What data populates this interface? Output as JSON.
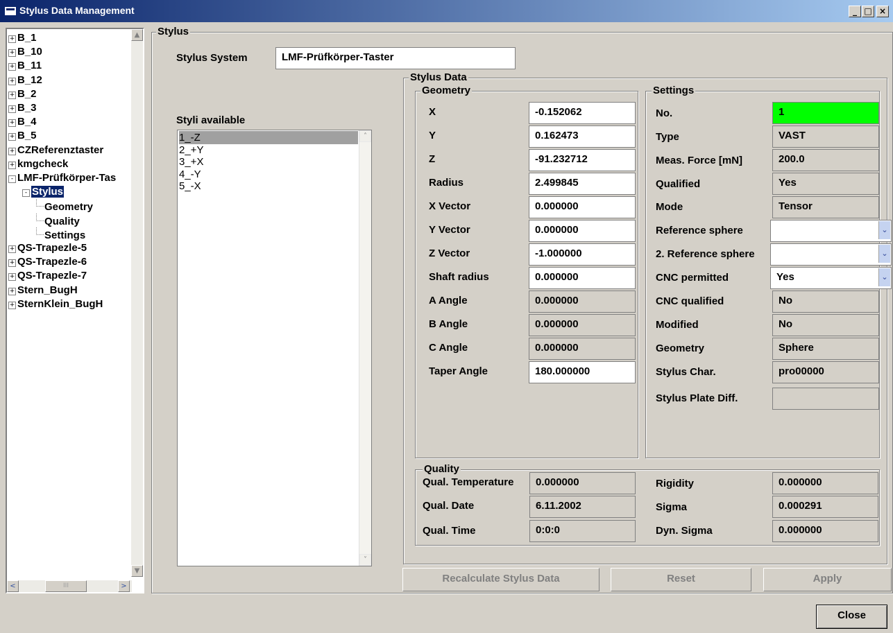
{
  "window": {
    "title": "Stylus Data Management",
    "min_label": "_",
    "max_label": "□",
    "close_label": "×"
  },
  "tree": {
    "items": [
      {
        "label": "B_1",
        "expander": "+"
      },
      {
        "label": "B_10",
        "expander": "+"
      },
      {
        "label": "B_11",
        "expander": "+"
      },
      {
        "label": "B_12",
        "expander": "+"
      },
      {
        "label": "B_2",
        "expander": "+"
      },
      {
        "label": "B_3",
        "expander": "+"
      },
      {
        "label": "B_4",
        "expander": "+"
      },
      {
        "label": "B_5",
        "expander": "+"
      },
      {
        "label": "CZReferenztaster",
        "expander": "+"
      },
      {
        "label": "kmgcheck",
        "expander": "+"
      },
      {
        "label": "LMF-Prüfkörper-Tas",
        "expander": "-"
      },
      {
        "label": "Stylus",
        "expander": "-"
      },
      {
        "label": "Geometry"
      },
      {
        "label": "Quality"
      },
      {
        "label": "Settings"
      },
      {
        "label": "QS-Trapezle-5",
        "expander": "+"
      },
      {
        "label": "QS-Trapezle-6",
        "expander": "+"
      },
      {
        "label": "QS-Trapezle-7",
        "expander": "+"
      },
      {
        "label": "Stern_BugH",
        "expander": "+"
      },
      {
        "label": "SternKlein_BugH",
        "expander": "+"
      }
    ],
    "scroll_left": "<",
    "scroll_right": ">",
    "scroll_thumb": "III"
  },
  "stylus": {
    "group_label": "Stylus",
    "system_label": "Stylus System",
    "system_value": "LMF-Prüfkörper-Taster",
    "styli_label": "Styli available",
    "styli": [
      "1_-Z",
      "2_+Y",
      "3_+X",
      "4_-Y",
      "5_-X"
    ]
  },
  "stylus_data": {
    "group_label": "Stylus Data",
    "geometry": {
      "group_label": "Geometry",
      "rows": [
        {
          "label": "X",
          "value": "-0.152062",
          "editable": true
        },
        {
          "label": "Y",
          "value": "0.162473",
          "editable": true
        },
        {
          "label": "Z",
          "value": "-91.232712",
          "editable": true
        },
        {
          "label": "Radius",
          "value": "2.499845",
          "editable": true
        },
        {
          "label": "X Vector",
          "value": "0.000000",
          "editable": true
        },
        {
          "label": "Y Vector",
          "value": "0.000000",
          "editable": true
        },
        {
          "label": "Z Vector",
          "value": "-1.000000",
          "editable": true
        },
        {
          "label": "Shaft radius",
          "value": "0.000000",
          "editable": true
        },
        {
          "label": "A Angle",
          "value": "0.000000",
          "editable": false
        },
        {
          "label": "B Angle",
          "value": "0.000000",
          "editable": false
        },
        {
          "label": "C Angle",
          "value": "0.000000",
          "editable": false
        },
        {
          "label": "Taper Angle",
          "value": "180.000000",
          "editable": true
        }
      ]
    },
    "settings": {
      "group_label": "Settings",
      "no_label": "No.",
      "no_value": "1",
      "type_label": "Type",
      "type_value": "VAST",
      "force_label": "Meas. Force [mN]",
      "force_value": "200.0",
      "qualified_label": "Qualified",
      "qualified_value": "Yes",
      "mode_label": "Mode",
      "mode_value": "Tensor",
      "ref_label": "Reference sphere",
      "ref_value": "",
      "ref2_label": "2. Reference sphere",
      "ref2_value": "",
      "cnc_label": "CNC permitted",
      "cnc_value": "Yes",
      "cncq_label": "CNC qualified",
      "cncq_value": "No",
      "modified_label": "Modified",
      "modified_value": "No",
      "geometry_label": "Geometry",
      "geometry_value": "Sphere",
      "char_label": "Stylus Char.",
      "char_value": "pro00000",
      "plate_label": "Stylus Plate Diff.",
      "plate_value": "",
      "highlight_color": "#00ff00"
    },
    "quality": {
      "group_label": "Quality",
      "temp_label": "Qual. Temperature",
      "temp_value": "0.000000",
      "date_label": "Qual. Date",
      "date_value": "6.11.2002",
      "time_label": "Qual. Time",
      "time_value": "0:0:0",
      "rigidity_label": "Rigidity",
      "rigidity_value": "0.000000",
      "sigma_label": "Sigma",
      "sigma_value": "0.000291",
      "dyn_label": "Dyn. Sigma",
      "dyn_value": "0.000000"
    }
  },
  "buttons": {
    "recalc": "Recalculate Stylus Data",
    "reset": "Reset",
    "apply": "Apply",
    "close": "Close"
  },
  "icons": {
    "combo_arrow": "chevron-down-icon",
    "app": "app-window-icon"
  }
}
